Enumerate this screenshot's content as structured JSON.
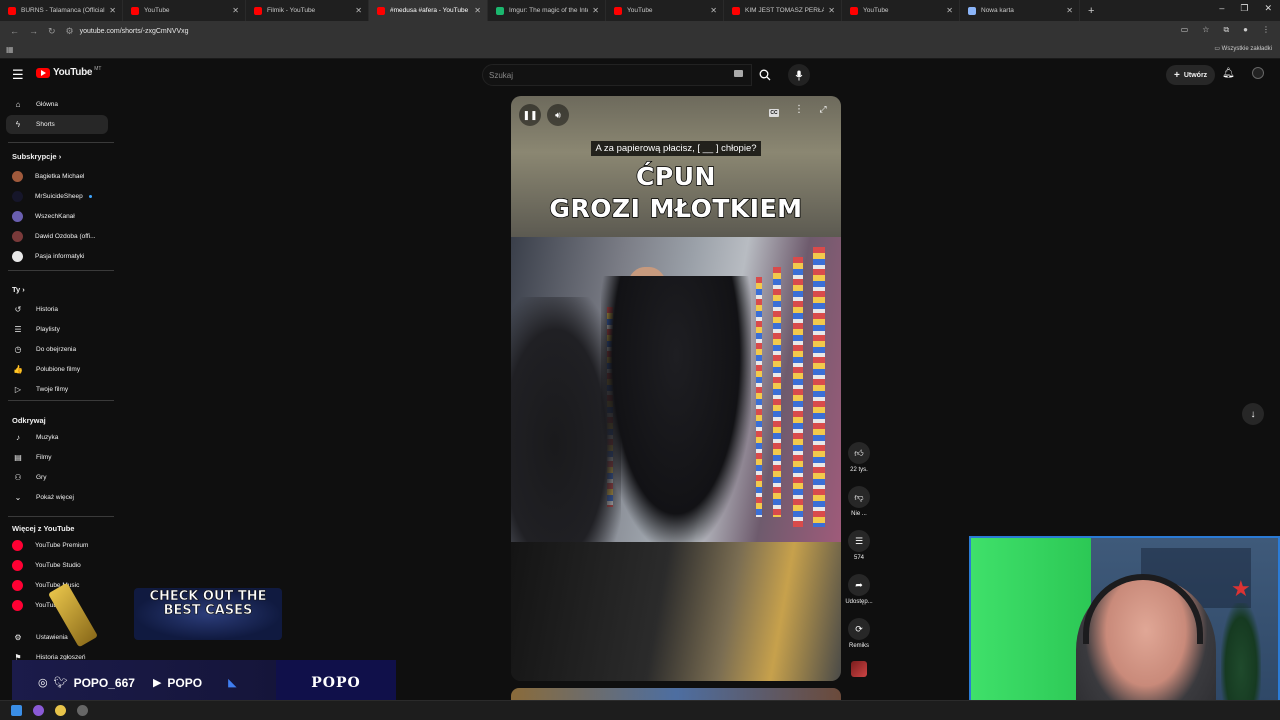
{
  "browser": {
    "tabs": [
      {
        "title": "BURNS - Talamanca (Official Vi",
        "color": "#ff0000",
        "active": false
      },
      {
        "title": "YouTube",
        "color": "#ff0000",
        "active": false
      },
      {
        "title": "Filmik - YouTube",
        "color": "#ff0000",
        "active": false
      },
      {
        "title": "#medusa #afera - YouTube",
        "color": "#ff0000",
        "active": true
      },
      {
        "title": "Imgur: The magic of the Intern",
        "color": "#1bb76e",
        "active": false
      },
      {
        "title": "YouTube",
        "color": "#ff0000",
        "active": false
      },
      {
        "title": "KIM JEST TOMASZ PERŁA? Hist",
        "color": "#ff0000",
        "active": false
      },
      {
        "title": "YouTube",
        "color": "#ff0000",
        "active": false
      },
      {
        "title": "Nowa karta",
        "color": "#8ab4f8",
        "active": false
      }
    ],
    "url": "youtube.com/shorts/-zxgCmNVVxg",
    "all_bookmarks": "Wszystkie zakładki"
  },
  "header": {
    "logo_text": "YouTube",
    "logo_region": "MT",
    "search_placeholder": "Szukaj",
    "create_label": "Utwórz"
  },
  "sidebar": {
    "main": [
      {
        "label": "Główna",
        "icon": "home-icon",
        "glyph": "⌂"
      },
      {
        "label": "Shorts",
        "icon": "shorts-icon",
        "glyph": "ϟ"
      }
    ],
    "subs_title": "Subskrypcje",
    "subs": [
      {
        "label": "Bagietka Michael",
        "color": "#a05a3c"
      },
      {
        "label": "MrSuicideSheep",
        "color": "#16162a"
      },
      {
        "label": "WszechKanał",
        "color": "#6a5fb0"
      },
      {
        "label": "Dawid Ozdoba (offi...",
        "color": "#7a3a3a"
      },
      {
        "label": "Pasja informatyki",
        "color": "#e8e8e8"
      }
    ],
    "you_title": "Ty",
    "you": [
      {
        "label": "Historia",
        "icon": "history-icon",
        "glyph": "↺"
      },
      {
        "label": "Playlisty",
        "icon": "playlists-icon",
        "glyph": "☰"
      },
      {
        "label": "Do obejrzenia",
        "icon": "watch-later-icon",
        "glyph": "◷"
      },
      {
        "label": "Polubione filmy",
        "icon": "liked-videos-icon",
        "glyph": "👍"
      },
      {
        "label": "Twoje filmy",
        "icon": "your-videos-icon",
        "glyph": "▷"
      }
    ],
    "explore_title": "Odkrywaj",
    "explore": [
      {
        "label": "Muzyka",
        "icon": "music-icon",
        "glyph": "♪"
      },
      {
        "label": "Filmy",
        "icon": "movies-icon",
        "glyph": "▤"
      },
      {
        "label": "Gry",
        "icon": "gaming-icon",
        "glyph": "⚇"
      },
      {
        "label": "Pokaż więcej",
        "icon": "chevron-down-icon",
        "glyph": "⌄"
      }
    ],
    "more_title": "Więcej z YouTube",
    "more": [
      {
        "label": "YouTube Premium",
        "color": "#ff0033"
      },
      {
        "label": "YouTube Studio",
        "color": "#ff0033"
      },
      {
        "label": "YouTube Music",
        "color": "#ff0033"
      },
      {
        "label": "YouTube Kids",
        "color": "#ff0033"
      }
    ],
    "settings": [
      {
        "label": "Ustawienia",
        "icon": "settings-icon",
        "glyph": "⚙"
      },
      {
        "label": "Historia zgłoszeń",
        "icon": "report-history-icon",
        "glyph": "⚑"
      }
    ]
  },
  "short": {
    "subtitle": "A za papierową płacisz, [ __ ] chłopie?",
    "caption_line1": "ĆPUN",
    "caption_line2": "GROZI MŁOTKIEM"
  },
  "actions": {
    "likes": "22 tys.",
    "dislike": "Nie ...",
    "comments": "574",
    "share": "Udostęp...",
    "remix": "Remiks"
  },
  "overlay": {
    "promo_text": "CHECK OUT THE BEST CASES",
    "social_handle": "POPO_667",
    "social_name": "POPO",
    "brand": "POPO"
  }
}
